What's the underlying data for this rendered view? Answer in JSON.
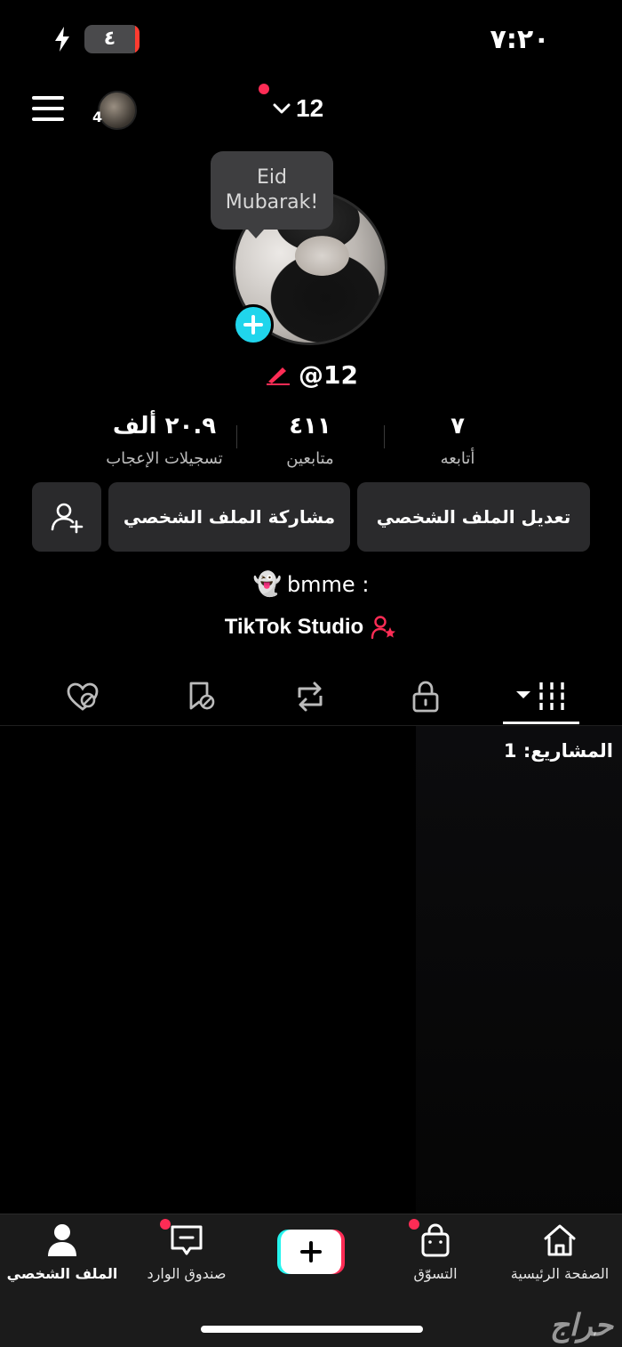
{
  "status_bar": {
    "time": "٧:٢٠",
    "battery": "٤"
  },
  "header": {
    "title": "12",
    "account_badge_count": "4"
  },
  "profile": {
    "bubble_line1": "Eid",
    "bubble_line2": "Mubarak!",
    "username": "@12",
    "stats": {
      "following_value": "٧",
      "following_label": "أتابعه",
      "followers_value": "٤١١",
      "followers_label": "متابعين",
      "likes_value": "٢٠.٩ ألف",
      "likes_label": "تسجيلات الإعجاب"
    },
    "buttons": {
      "edit": "تعديل الملف الشخصي",
      "share": "مشاركة الملف الشخصي"
    },
    "bio": "bmme :",
    "bio_emoji": "👻",
    "studio": "TikTok Studio"
  },
  "content": {
    "projects": "المشاريع: 1"
  },
  "bottom_nav": {
    "home": "الصفحة الرئيسية",
    "shop": "التسوّق",
    "inbox": "صندوق الوارد",
    "profile": "الملف الشخصي"
  },
  "watermark": "حراج",
  "colors": {
    "accent_red": "#fe2c55",
    "accent_cyan": "#20d5ec",
    "background": "#000000",
    "button_bg": "#2a2a2c"
  }
}
